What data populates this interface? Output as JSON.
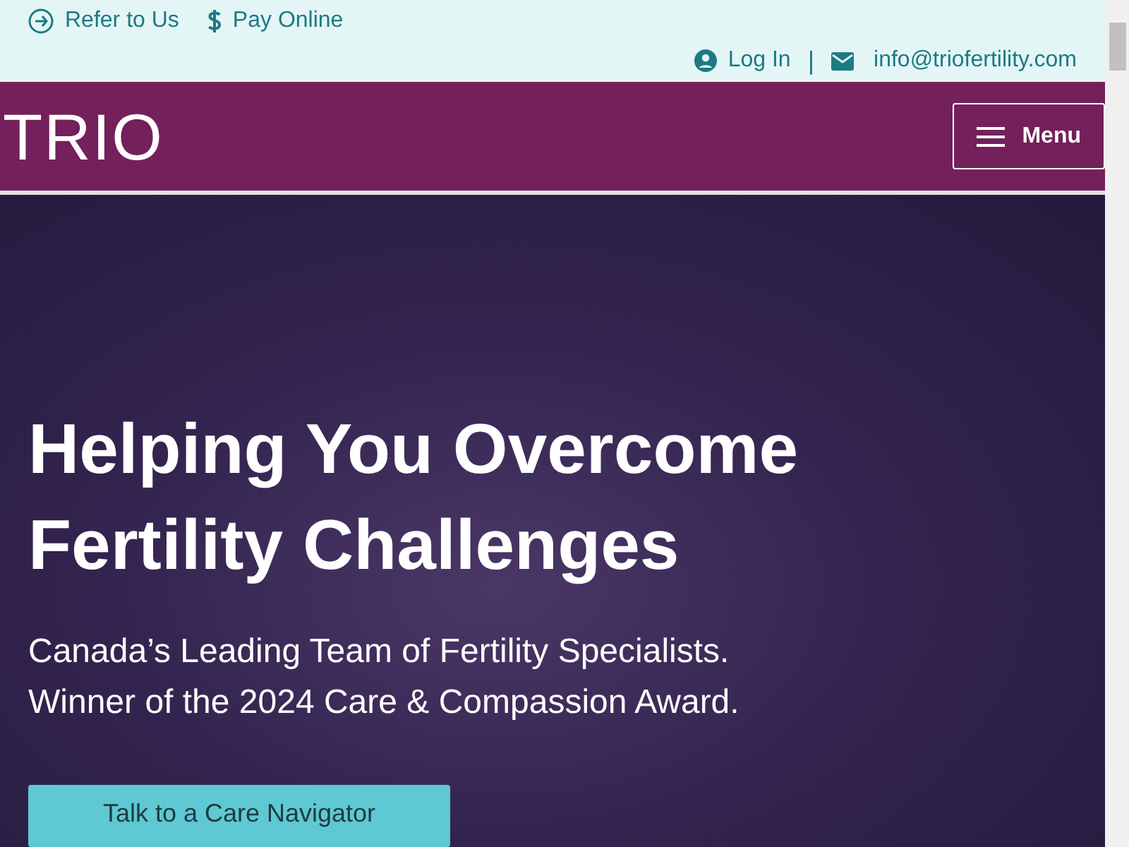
{
  "top_bar": {
    "links": [
      {
        "kind": "refer",
        "label": "Refer to Us"
      },
      {
        "kind": "pay",
        "label": "Pay Online"
      }
    ],
    "account": {
      "login": "Log In",
      "separator": "|",
      "email": "info@triofertility.com"
    }
  },
  "header": {
    "logo": "TRIO",
    "menu_button": "Menu"
  },
  "hero": {
    "title_lines": [
      "Helping You Overcome",
      "Fertility Challenges"
    ],
    "subtitle_lines": [
      "Canada’s Leading Team of Fertility Specialists.",
      "Winner of the 2024 Care & Compassion Award."
    ],
    "cta": "Talk to a Care Navigator"
  }
}
